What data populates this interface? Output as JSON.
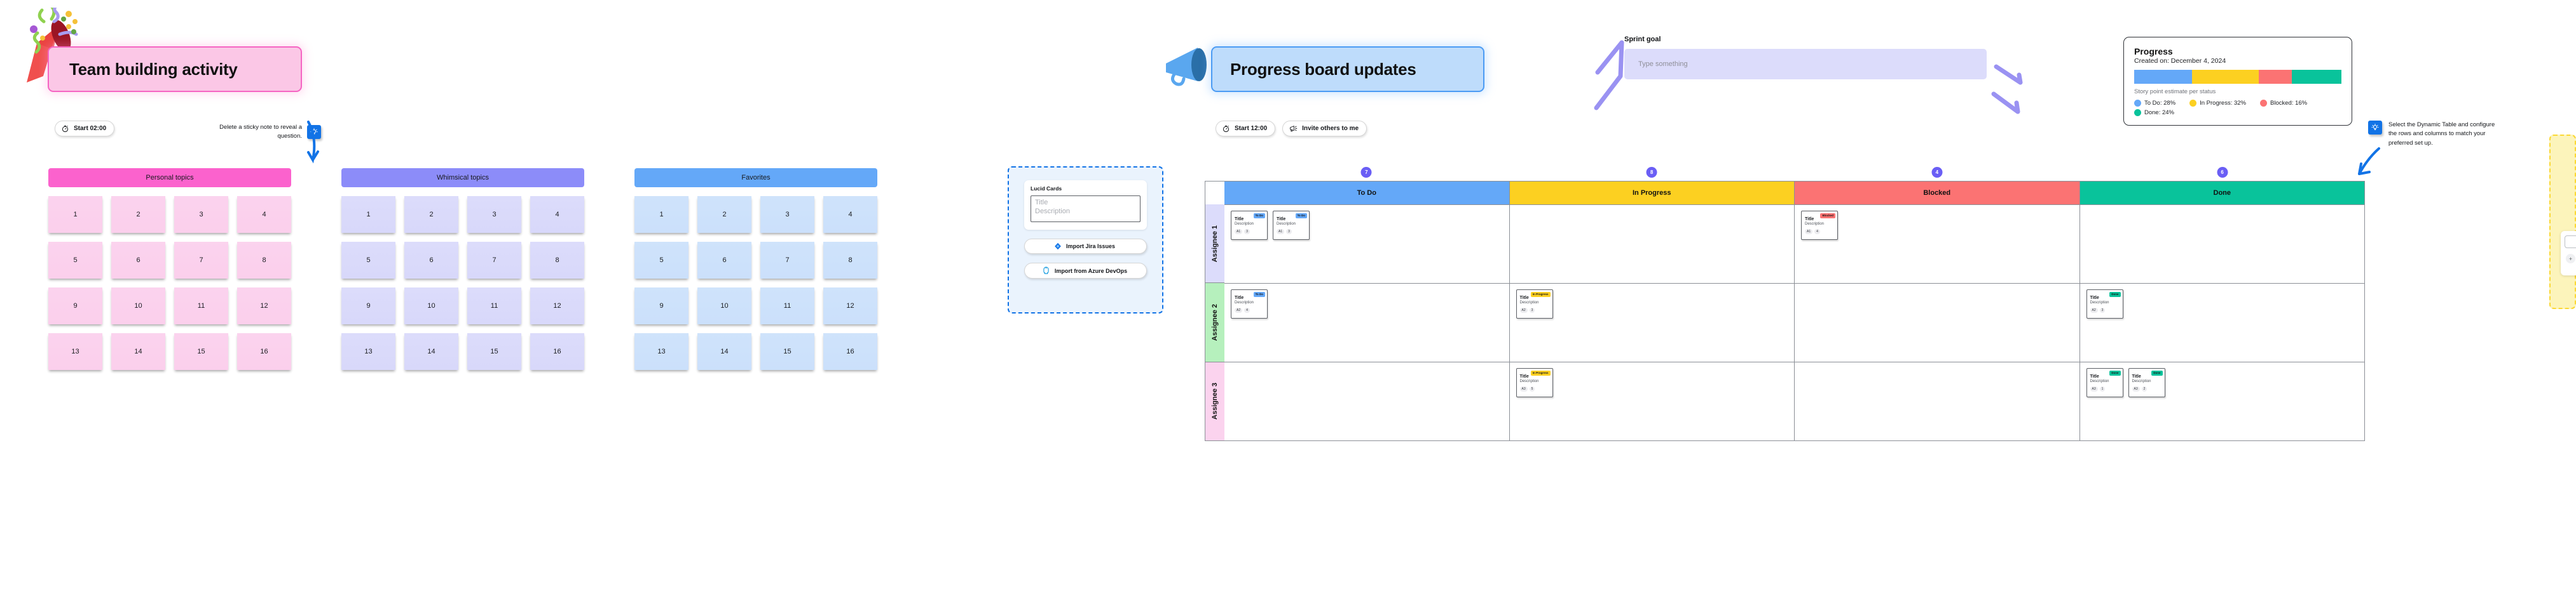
{
  "team_building": {
    "title": "Team building activity",
    "timer_label": "Start 02:00",
    "timer_icon": "stopwatch-icon",
    "hint": "Delete a sticky note to reveal a question.",
    "hint_icon": "lightbulb-icon",
    "grids": [
      {
        "heading": "Personal topics",
        "theme": "pink",
        "notes": [
          "1",
          "2",
          "3",
          "4",
          "5",
          "6",
          "7",
          "8",
          "9",
          "10",
          "11",
          "12",
          "13",
          "14",
          "15",
          "16"
        ]
      },
      {
        "heading": "Whimsical topics",
        "theme": "purple",
        "notes": [
          "1",
          "2",
          "3",
          "4",
          "5",
          "6",
          "7",
          "8",
          "9",
          "10",
          "11",
          "12",
          "13",
          "14",
          "15",
          "16"
        ]
      },
      {
        "heading": "Favorites",
        "theme": "blue",
        "notes": [
          "1",
          "2",
          "3",
          "4",
          "5",
          "6",
          "7",
          "8",
          "9",
          "10",
          "11",
          "12",
          "13",
          "14",
          "15",
          "16"
        ]
      }
    ]
  },
  "progress_board": {
    "title": "Progress board updates",
    "timer_label": "Start 12:00",
    "timer_icon": "stopwatch-icon",
    "invite_label": "Invite others to me",
    "invite_icon": "megaphone-icon",
    "header_icon": "megaphone-icon"
  },
  "sprint_goal": {
    "label": "Sprint goal",
    "value": "",
    "placeholder": "Type something"
  },
  "progress_card": {
    "title": "Progress",
    "created": "Created on: December 4, 2024",
    "bar_caption": "Story point estimate per status",
    "chart_data": {
      "type": "bar",
      "title": "Progress",
      "subtitle": "Story point estimate per status",
      "orientation": "horizontal-stacked",
      "categories": [
        "To Do",
        "In Progress",
        "Blocked",
        "Done"
      ],
      "values": [
        28,
        32,
        16,
        24
      ],
      "unit": "%",
      "colors": [
        "#64a8f8",
        "#fcd021",
        "#fb7373",
        "#09c39b"
      ],
      "labels": [
        "To Do: 28%",
        "In Progress: 32%",
        "Blocked: 16%",
        "Done: 24%"
      ],
      "legend_position": "bottom",
      "grid": false
    }
  },
  "import_panel": {
    "lucid_label": "Lucid Cards",
    "card_title_placeholder": "Title",
    "card_desc_placeholder": "Description",
    "jira_label": "Import Jira Issues",
    "jira_icon": "jira-icon",
    "azure_label": "Import from Azure DevOps",
    "azure_icon": "azure-devops-icon"
  },
  "kanban": {
    "columns": [
      {
        "label": "To Do",
        "color": "#64a8f8",
        "badge": "7"
      },
      {
        "label": "In Progress",
        "color": "#fcd021",
        "badge": "8"
      },
      {
        "label": "Blocked",
        "color": "#fb7373",
        "badge": "4"
      },
      {
        "label": "Done",
        "color": "#09c39b",
        "badge": "6"
      }
    ],
    "rows": [
      {
        "label": "Assignee 1",
        "theme": "r1",
        "cells": [
          [
            {
              "title": "Title",
              "desc": "Description",
              "tags": [
                "A1",
                "3"
              ],
              "status": "To Do",
              "status_class": "b-todo"
            },
            {
              "title": "Title",
              "desc": "Description",
              "tags": [
                "A1",
                "3"
              ],
              "status": "To Do",
              "status_class": "b-todo"
            }
          ],
          [],
          [
            {
              "title": "Title",
              "desc": "Description",
              "tags": [
                "A1",
                "4"
              ],
              "status": "Blocked",
              "status_class": "b-block"
            }
          ],
          []
        ]
      },
      {
        "label": "Assignee 2",
        "theme": "r2",
        "cells": [
          [
            {
              "title": "Title",
              "desc": "Description",
              "tags": [
                "A2",
                "4"
              ],
              "status": "To Do",
              "status_class": "b-todo"
            }
          ],
          [
            {
              "title": "Title",
              "desc": "Description",
              "tags": [
                "A2",
                "3"
              ],
              "status": "In Progress",
              "status_class": "b-prog"
            }
          ],
          [],
          [
            {
              "title": "Title",
              "desc": "Description",
              "tags": [
                "A2",
                "3"
              ],
              "status": "Done",
              "status_class": "b-done"
            }
          ]
        ]
      },
      {
        "label": "Assignee 3",
        "theme": "r3",
        "cells": [
          [],
          [
            {
              "title": "Title",
              "desc": "Description",
              "tags": [
                "A3",
                "5"
              ],
              "status": "In Progress",
              "status_class": "b-prog"
            }
          ],
          [],
          [
            {
              "title": "Title",
              "desc": "Description",
              "tags": [
                "A3",
                "1"
              ],
              "status": "Done",
              "status_class": "b-done"
            },
            {
              "title": "Title",
              "desc": "Description",
              "tags": [
                "A3",
                "2"
              ],
              "status": "Done",
              "status_class": "b-done"
            }
          ]
        ]
      }
    ]
  },
  "right_hint": {
    "icon": "lightbulb-icon",
    "text": "Select the Dynamic Table and configure the rows and columns to match your preferred set up."
  },
  "yellow_strip": {
    "plus_label": "+"
  }
}
